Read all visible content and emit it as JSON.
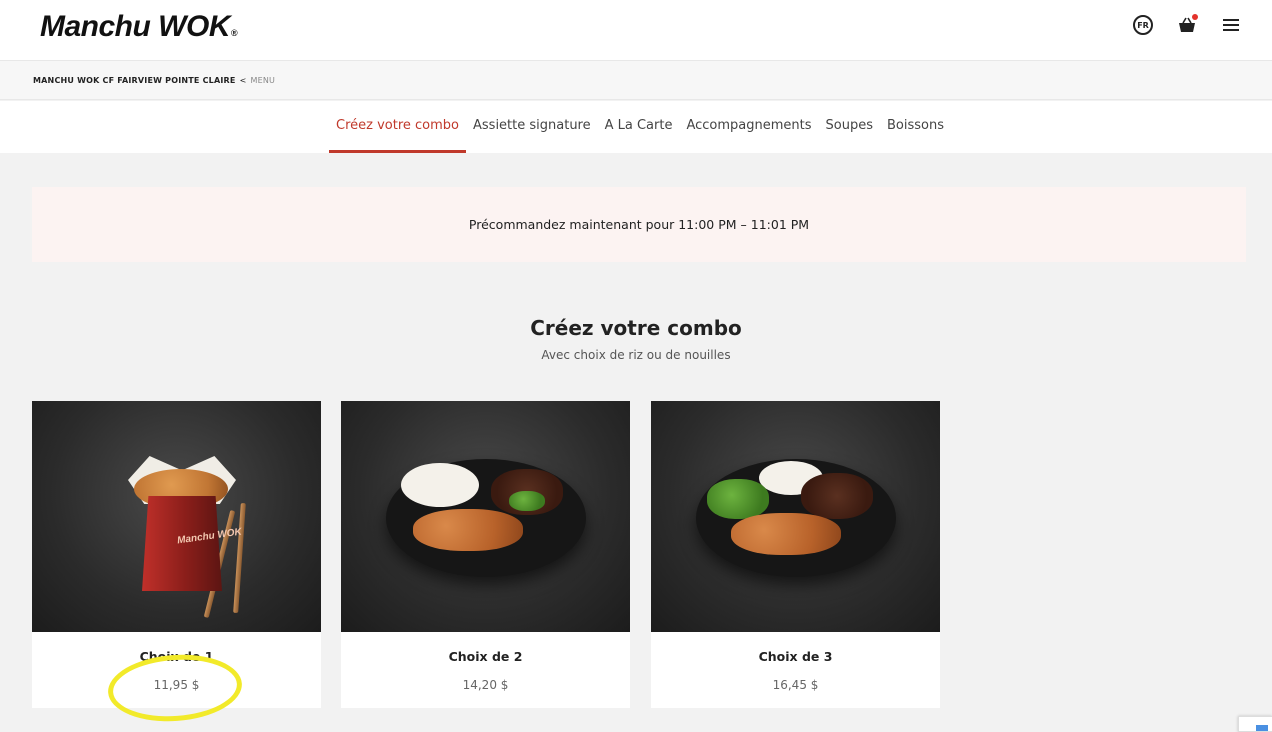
{
  "header": {
    "logo_text": "Manchu WOK",
    "logo_reg": "®",
    "lang_label": "FR",
    "icons": [
      "language-icon",
      "cart-icon",
      "menu-icon"
    ]
  },
  "breadcrumb": {
    "store": "MANCHU WOK CF FAIRVIEW POINTE CLAIRE",
    "separator": "<",
    "current": "MENU"
  },
  "tabs": [
    {
      "label": "Créez votre combo",
      "active": true
    },
    {
      "label": "Assiette signature",
      "active": false
    },
    {
      "label": "A La Carte",
      "active": false
    },
    {
      "label": "Accompagnements",
      "active": false
    },
    {
      "label": "Soupes",
      "active": false
    },
    {
      "label": "Boissons",
      "active": false
    }
  ],
  "banner": {
    "text": "Précommandez maintenant pour 11:00 PM – 11:01 PM"
  },
  "section": {
    "title": "Créez votre combo",
    "subtitle": "Avec choix de riz ou de nouilles"
  },
  "cards": [
    {
      "name": "Choix de 1",
      "price": "11,95 $"
    },
    {
      "name": "Choix de 2",
      "price": "14,20 $"
    },
    {
      "name": "Choix de 3",
      "price": "16,45 $"
    }
  ],
  "colors": {
    "accent": "#c0392b",
    "banner_bg": "#fcf3f2",
    "highlight": "#f2ea2a"
  }
}
